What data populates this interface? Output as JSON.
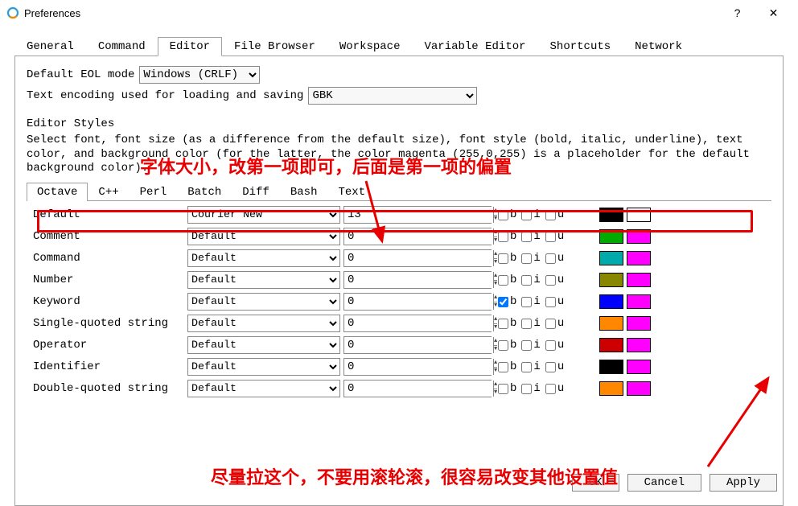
{
  "window": {
    "title": "Preferences",
    "helpBtn": "?",
    "closeBtn": "✕"
  },
  "tabs": [
    "General",
    "Command",
    "Editor",
    "File Browser",
    "Workspace",
    "Variable Editor",
    "Shortcuts",
    "Network"
  ],
  "activeTab": "Editor",
  "eol": {
    "label": "Default EOL mode",
    "value": "Windows (CRLF)"
  },
  "encoding": {
    "label": "Text encoding used for loading and saving",
    "value": "GBK"
  },
  "stylesTitle": "Editor Styles",
  "stylesDesc": "Select font, font size (as a difference from the default size), font style (bold, italic, underline), text color, and background color (for the latter, the color magenta (255,0,255) is a placeholder for the default background color).",
  "subTabs": [
    "Octave",
    "C++",
    "Perl",
    "Batch",
    "Diff",
    "Bash",
    "Text"
  ],
  "activeSubTab": "Octave",
  "checkLabels": {
    "b": "b",
    "i": "i",
    "u": "u"
  },
  "styles": [
    {
      "name": "Default",
      "font": "Courier New",
      "size": "13",
      "b": false,
      "i": false,
      "u": false,
      "fg": "#000000",
      "bg": "#ffffff"
    },
    {
      "name": "Comment",
      "font": "Default",
      "size": "0",
      "b": false,
      "i": false,
      "u": false,
      "fg": "#00aa00",
      "bg": "#ff00ff"
    },
    {
      "name": "Command",
      "font": "Default",
      "size": "0",
      "b": false,
      "i": false,
      "u": false,
      "fg": "#00aaaa",
      "bg": "#ff00ff"
    },
    {
      "name": "Number",
      "font": "Default",
      "size": "0",
      "b": false,
      "i": false,
      "u": false,
      "fg": "#888800",
      "bg": "#ff00ff"
    },
    {
      "name": "Keyword",
      "font": "Default",
      "size": "0",
      "b": true,
      "i": false,
      "u": false,
      "fg": "#0000ff",
      "bg": "#ff00ff"
    },
    {
      "name": "Single-quoted string",
      "font": "Default",
      "size": "0",
      "b": false,
      "i": false,
      "u": false,
      "fg": "#ff8800",
      "bg": "#ff00ff"
    },
    {
      "name": "Operator",
      "font": "Default",
      "size": "0",
      "b": false,
      "i": false,
      "u": false,
      "fg": "#cc0000",
      "bg": "#ff00ff"
    },
    {
      "name": "Identifier",
      "font": "Default",
      "size": "0",
      "b": false,
      "i": false,
      "u": false,
      "fg": "#000000",
      "bg": "#ff00ff"
    },
    {
      "name": "Double-quoted string",
      "font": "Default",
      "size": "0",
      "b": false,
      "i": false,
      "u": false,
      "fg": "#ff8800",
      "bg": "#ff00ff"
    }
  ],
  "annotations": {
    "top": "字体大小，改第一项即可，后面是第一项的偏置",
    "bottom": "尽量拉这个，不要用滚轮滚，很容易改变其他设置值"
  },
  "buttons": {
    "ok": "OK",
    "cancel": "Cancel",
    "apply": "Apply"
  }
}
